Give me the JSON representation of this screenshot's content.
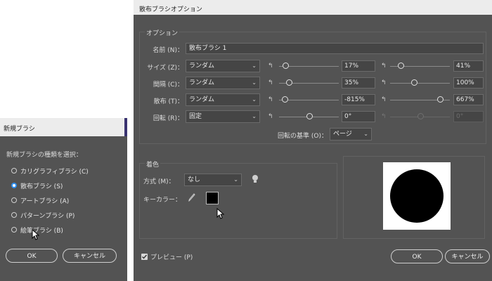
{
  "new_brush": {
    "title": "新規ブラシ",
    "prompt": "新規ブラシの種類を選択：",
    "options": [
      {
        "label": "カリグラフィブラシ (C)",
        "selected": false
      },
      {
        "label": "散布ブラシ (S)",
        "selected": true
      },
      {
        "label": "アートブラシ (A)",
        "selected": false
      },
      {
        "label": "パターンブラシ (P)",
        "selected": false
      },
      {
        "label": "絵筆ブラシ (B)",
        "selected": false
      }
    ],
    "ok_label": "OK",
    "cancel_label": "キャンセル"
  },
  "scatter": {
    "title": "散布ブラシオプション",
    "options_section": "オプション",
    "name_label": "名前 (N)：",
    "name_value": "散布ブラシ 1",
    "rows": [
      {
        "label": "サイズ (Z)：",
        "method": "ランダム",
        "min": "17%",
        "max": "41%",
        "min_pos": 0.1,
        "max_pos": 0.18,
        "disabled_max": false
      },
      {
        "label": "間隔 (C)：",
        "method": "ランダム",
        "min": "35%",
        "max": "100%",
        "min_pos": 0.17,
        "max_pos": 0.4,
        "disabled_max": false
      },
      {
        "label": "散布 (T)：",
        "method": "ランダム",
        "min": "-815%",
        "max": "667%",
        "min_pos": 0.09,
        "max_pos": 0.83,
        "disabled_max": false
      },
      {
        "label": "回転 (R)：",
        "method": "固定",
        "min": "0°",
        "max": "0°",
        "min_pos": 0.5,
        "max_pos": 0.5,
        "disabled_max": true
      }
    ],
    "rotation_base_label": "回転の基準 (O)：",
    "rotation_base_value": "ページ",
    "colorize_section": "着色",
    "method_label": "方式 (M)：",
    "method_value": "なし",
    "key_color_label": "キーカラー：",
    "key_color": "#000000",
    "preview_label": "プレビュー (P)",
    "preview_checked": true,
    "ok_label": "OK",
    "cancel_label": "キャンセル"
  }
}
